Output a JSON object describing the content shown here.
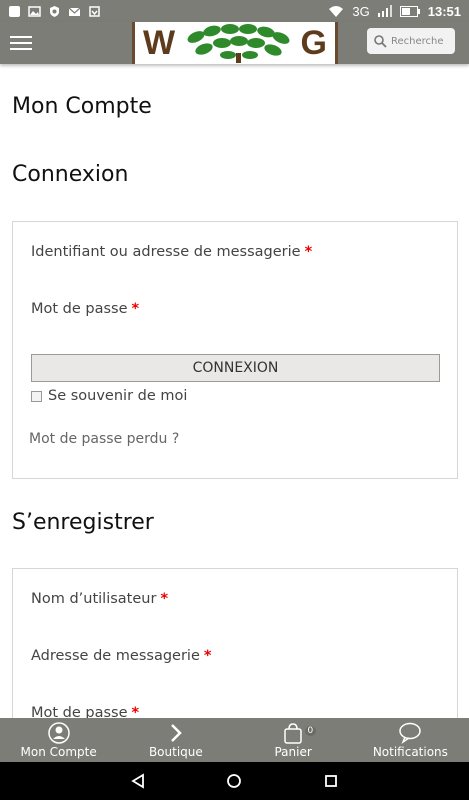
{
  "status_bar": {
    "network": "3G",
    "time": "13:51"
  },
  "header": {
    "logo_left": "W",
    "logo_right": "G",
    "search_placeholder": "Recherche"
  },
  "page": {
    "title": "Mon Compte"
  },
  "login": {
    "title": "Connexion",
    "username_label": "Identifiant ou adresse de messagerie",
    "password_label": "Mot de passe",
    "required_mark": "*",
    "button_label": "CONNEXION",
    "remember_label": "Se souvenir de moi",
    "lost_password_link": "Mot de passe perdu ?"
  },
  "register": {
    "title": "S’enregistrer",
    "username_label": "Nom d’utilisateur",
    "email_label": "Adresse de messagerie",
    "password_label": "Mot de passe",
    "required_mark": "*"
  },
  "tabs": [
    {
      "label": "Mon Compte",
      "icon": "user-icon"
    },
    {
      "label": "Boutique",
      "icon": "chevron-right-icon"
    },
    {
      "label": "Panier",
      "icon": "bag-icon",
      "badge": "0"
    },
    {
      "label": "Notifications",
      "icon": "chat-bubble-icon"
    }
  ],
  "colors": {
    "bar": "#7b7d76",
    "logo_brown": "#5e3b1c",
    "logo_green": "#2f8a2b",
    "required": "#e00000"
  }
}
